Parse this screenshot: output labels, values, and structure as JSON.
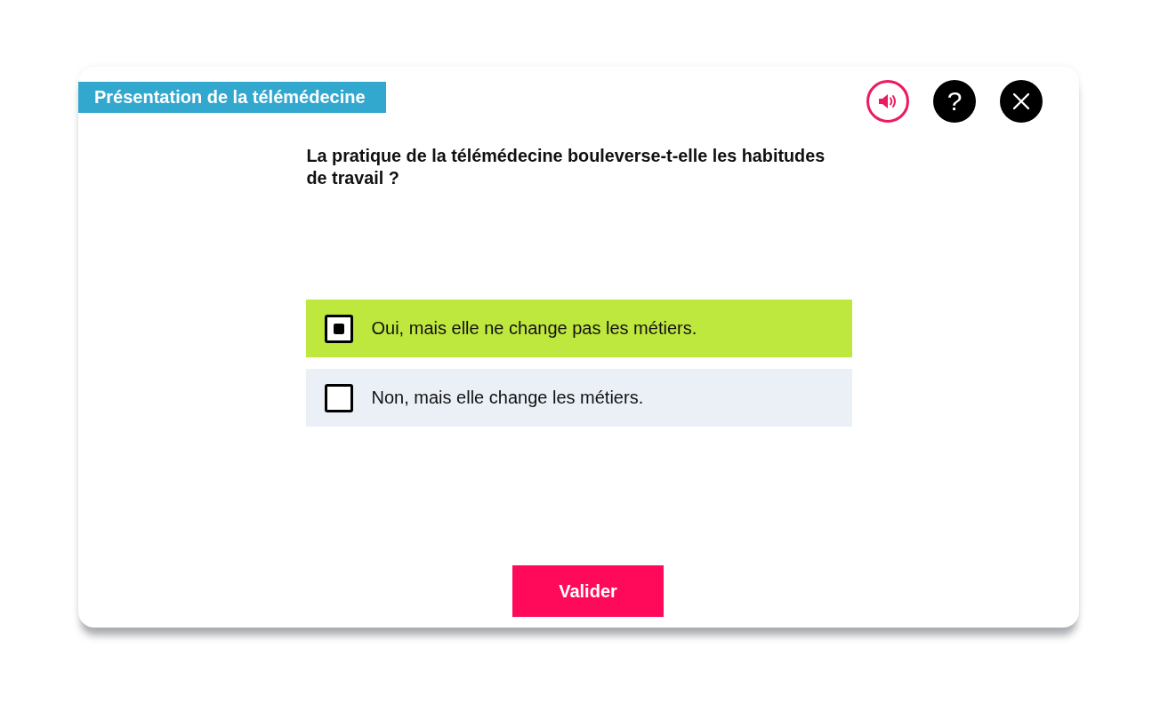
{
  "header": {
    "title": "Présentation de la télémédecine",
    "buttons": [
      {
        "kind": "sound"
      },
      {
        "kind": "help",
        "label": "?"
      },
      {
        "kind": "close"
      }
    ]
  },
  "question": "La pratique de la télémédecine bouleverse-t-elle les habitudes de travail ?",
  "options": [
    {
      "label": "Oui, mais elle ne change pas les métiers.",
      "selected": true
    },
    {
      "label": "Non, mais elle change les métiers.",
      "selected": false
    }
  ],
  "submit": {
    "label": "Valider"
  }
}
